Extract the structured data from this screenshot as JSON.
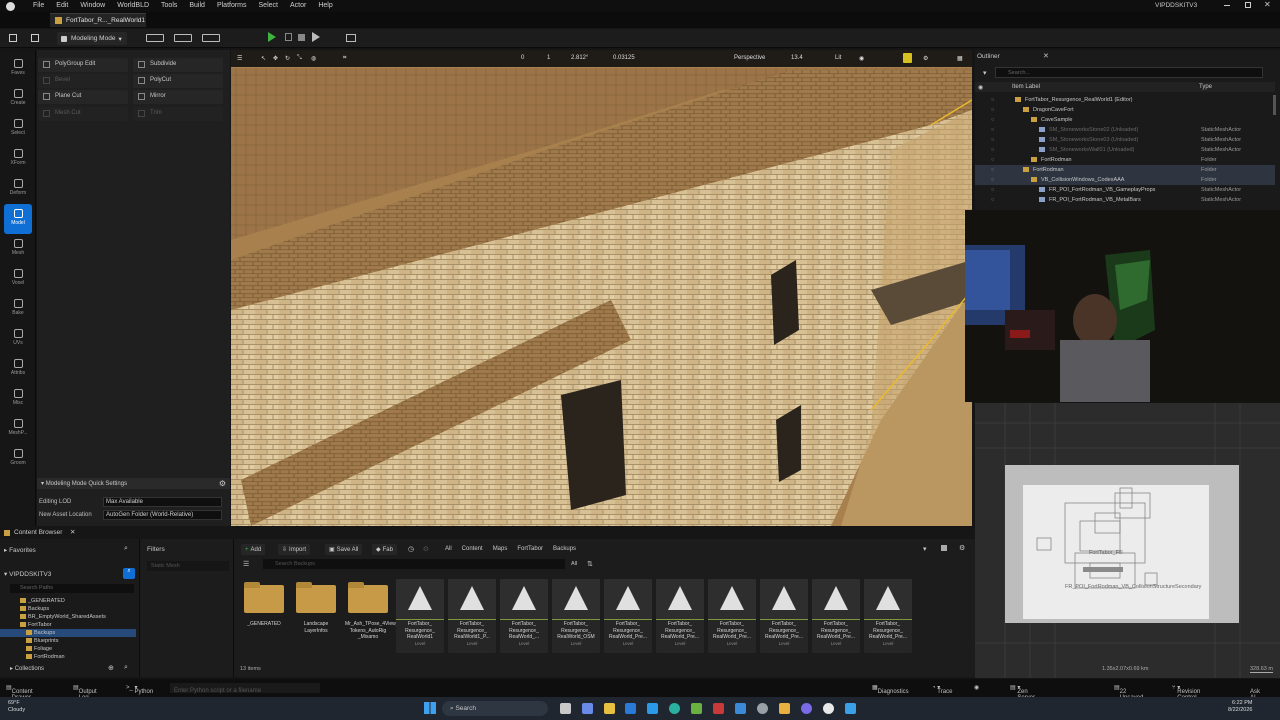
{
  "titlebar": {
    "menus": [
      "File",
      "Edit",
      "Window",
      "WorldBLD",
      "Tools",
      "Build",
      "Platforms",
      "Select",
      "Actor",
      "Help"
    ],
    "project": "VIPDDSKITV3"
  },
  "doc_tab": "FortTabor_R..._RealWorld1",
  "toolbar": {
    "mode": "Modeling Mode",
    "play": "Play",
    "chevron": "▾"
  },
  "modes": [
    {
      "label": "Faves",
      "icon": "star-icon"
    },
    {
      "label": "Create",
      "icon": "plus-icon"
    },
    {
      "label": "Select",
      "icon": "cursor-icon"
    },
    {
      "label": "XForm",
      "icon": "move-icon"
    },
    {
      "label": "Deform",
      "icon": "deform-icon"
    },
    {
      "label": "Model",
      "icon": "model-icon"
    },
    {
      "label": "Mesh",
      "icon": "mesh-icon"
    },
    {
      "label": "Voxel",
      "icon": "voxel-icon"
    },
    {
      "label": "Bake",
      "icon": "bake-icon"
    },
    {
      "label": "UVs",
      "icon": "uv-icon"
    },
    {
      "label": "Attribs",
      "icon": "attribs-icon"
    },
    {
      "label": "Misc",
      "icon": "misc-icon"
    },
    {
      "label": "MeshP...",
      "icon": "meshp-icon"
    },
    {
      "label": "Groom",
      "icon": "groom-icon"
    }
  ],
  "tools": [
    {
      "label": "PolyGroup Edit",
      "enabled": true
    },
    {
      "label": "Subdivide",
      "enabled": true
    },
    {
      "label": "Bevel",
      "enabled": false
    },
    {
      "label": "PolyCut",
      "enabled": true
    },
    {
      "label": "Plane Cut",
      "enabled": true
    },
    {
      "label": "Mirror",
      "enabled": true
    },
    {
      "label": "Mesh Cut",
      "enabled": false
    },
    {
      "label": "Trim",
      "enabled": false
    }
  ],
  "quick_settings": {
    "header": "Modeling Mode Quick Settings",
    "editing_lod_label": "Editing LOD",
    "editing_lod_value": "Max Available",
    "new_asset_label": "New Asset Location",
    "new_asset_value": "AutoGen Folder (World-Relative)"
  },
  "viewport": {
    "perspective": "Perspective",
    "lit": "Lit",
    "fov": "13.4",
    "grid": "0",
    "angle": "2.812°",
    "scale": "0.03125",
    "snap": "1"
  },
  "outliner": {
    "title": "Outliner",
    "search_placeholder": "Search...",
    "col_label": "Item Label",
    "col_type": "Type",
    "rows": [
      {
        "name": "FortTabor_Resurgence_RealWorld1 (Editor)",
        "type": "",
        "indent": 50,
        "state": "normal"
      },
      {
        "name": "DragonCaveFort",
        "type": "",
        "indent": 58,
        "state": "normal"
      },
      {
        "name": "CaveSample",
        "type": "",
        "indent": 66,
        "state": "normal"
      },
      {
        "name": "SM_StoneworksStone02 (Unloaded)",
        "type": "StaticMeshActor",
        "indent": 74,
        "state": "unloaded"
      },
      {
        "name": "SM_StoneworksStone03 (Unloaded)",
        "type": "StaticMeshActor",
        "indent": 74,
        "state": "unloaded"
      },
      {
        "name": "SM_StoneworksWall01 (Unloaded)",
        "type": "StaticMeshActor",
        "indent": 74,
        "state": "unloaded"
      },
      {
        "name": "FortRodman",
        "type": "Folder",
        "indent": 66,
        "state": "normal"
      },
      {
        "name": "FortRodman",
        "type": "Folder",
        "indent": 58,
        "state": "selected"
      },
      {
        "name": "VB_CollisionWindows_CodexAAA",
        "type": "Folder",
        "indent": 66,
        "state": "selected"
      },
      {
        "name": "FR_POI_FortRodman_VB_GameplayProps",
        "type": "StaticMeshActor",
        "indent": 74,
        "state": "normal"
      },
      {
        "name": "FR_POI_FortRodman_VB_MetalBars",
        "type": "StaticMeshActor",
        "indent": 74,
        "state": "normal"
      }
    ]
  },
  "minimap": {
    "label1": "FortTabor_Fill",
    "label2": "FR_POI_FortRodman_VB_CollisionStructureSecondary",
    "dims": "1.35x2.07x0.69 km",
    "scale": "328.63 m"
  },
  "content_browser": {
    "tab": "Content Browser",
    "favorites": "Favorites",
    "root": "VIPDDSKITV3",
    "search_paths": "Search Paths",
    "tree": [
      {
        "label": "_GENERATED",
        "indent": 28,
        "sel": false
      },
      {
        "label": "Backups",
        "indent": 28,
        "sel": false
      },
      {
        "label": "BR_EmptyWorld_SharedAssets",
        "indent": 28,
        "sel": false
      },
      {
        "label": "FortTabor",
        "indent": 28,
        "sel": false
      },
      {
        "label": "Backups",
        "indent": 34,
        "sel": true
      },
      {
        "label": "Blueprints",
        "indent": 34,
        "sel": false
      },
      {
        "label": "Foliage",
        "indent": 34,
        "sel": false
      },
      {
        "label": "FortRodman",
        "indent": 34,
        "sel": false
      }
    ],
    "collections": "Collections",
    "filters": "Filters",
    "filters_placeholder": "Static Mesh",
    "add": "Add",
    "import": "Import",
    "save_all": "Save All",
    "fab": "Fab",
    "breadcrumb": [
      "All",
      "Content",
      "Maps",
      "FortTabor",
      "Backups"
    ],
    "search_placeholder": "Search Backups",
    "search_scope": "All",
    "items": [
      {
        "name": "_GENERATED",
        "sub": "",
        "type": "folder"
      },
      {
        "name": "Landscape LayerInfos",
        "sub": "",
        "type": "folder"
      },
      {
        "name": "Mr_Ash_TPose_4View_2K_Skin Tokens_AutoRig _Mixamo",
        "sub": "",
        "type": "folder"
      },
      {
        "name": "FortTabor_ Resurgence_ RealWorld1",
        "sub": "Level",
        "type": "level"
      },
      {
        "name": "FortTabor_ Resurgence_ RealWorld1_P...",
        "sub": "Level",
        "type": "level"
      },
      {
        "name": "FortTabor_ Resurgence_ RealWorld_...",
        "sub": "Level",
        "type": "level"
      },
      {
        "name": "FortTabor_ Resurgence_ RealWorld_OSM",
        "sub": "Level",
        "type": "level"
      },
      {
        "name": "FortTabor_ Resurgence_ RealWorld_Pre...",
        "sub": "Level",
        "type": "level"
      },
      {
        "name": "FortTabor_ Resurgence_ RealWorld_Pre...",
        "sub": "Level",
        "type": "level"
      },
      {
        "name": "FortTabor_ Resurgence_ RealWorld_Pre...",
        "sub": "Level",
        "type": "level"
      },
      {
        "name": "FortTabor_ Resurgence_ RealWorld_Pre...",
        "sub": "Level",
        "type": "level"
      },
      {
        "name": "FortTabor_ Resurgence_ RealWorld_Pre...",
        "sub": "Level",
        "type": "level"
      },
      {
        "name": "FortTabor_ Resurgence_ RealWorld_Pre...",
        "sub": "Level",
        "type": "level"
      }
    ],
    "item_count": "13 items"
  },
  "statusbar": {
    "content_drawer": "Content Drawer",
    "output_log": "Output Log",
    "python": "Python",
    "python_placeholder": "Enter Python script or a filename",
    "diagnostics": "Diagnostics",
    "trace": "Trace",
    "zen": "Zen Server",
    "unsaved": "22 Unsaved",
    "revision": "Revision Control",
    "ask": "Ask AI"
  },
  "taskbar": {
    "weather_temp": "69°F",
    "weather_desc": "Cloudy",
    "search": "Search",
    "time": "6:22 PM",
    "date": "8/22/2026"
  },
  "colors": {
    "accent": "#0f6fd4",
    "selection_outline": "#e8b830",
    "level_stripe": "#7a9a3a"
  }
}
